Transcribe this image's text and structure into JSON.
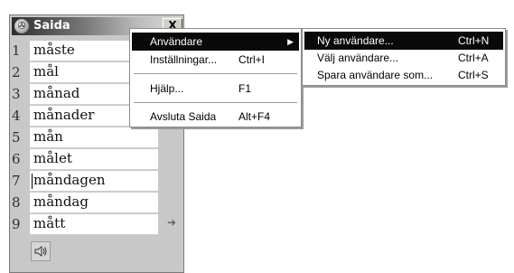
{
  "window": {
    "title": "Saida",
    "close_label": "X"
  },
  "word_list": [
    {
      "num": "1",
      "word": "måste"
    },
    {
      "num": "2",
      "word": "mål"
    },
    {
      "num": "3",
      "word": "månad"
    },
    {
      "num": "4",
      "word": "månader"
    },
    {
      "num": "5",
      "word": "mån"
    },
    {
      "num": "6",
      "word": "målet"
    },
    {
      "num": "7",
      "word": "måndagen"
    },
    {
      "num": "8",
      "word": "måndag"
    },
    {
      "num": "9",
      "word": "mått"
    }
  ],
  "icons": {
    "app": "saida-app-icon",
    "more": "arrow-right-icon",
    "speaker": "speaker-icon",
    "submenu": "submenu-arrow-icon"
  },
  "main_menu": {
    "items": [
      {
        "label": "Användare",
        "shortcut": ""
      },
      {
        "label": "Inställningar...",
        "shortcut": "Ctrl+I"
      },
      {
        "label": "Hjälp...",
        "shortcut": "F1"
      },
      {
        "label": "Avsluta Saida",
        "shortcut": "Alt+F4"
      }
    ]
  },
  "sub_menu": {
    "items": [
      {
        "label": "Ny användare...",
        "shortcut": "Ctrl+N"
      },
      {
        "label": "Välj användare...",
        "shortcut": "Ctrl+A"
      },
      {
        "label": "Spara användare som...",
        "shortcut": "Ctrl+S"
      }
    ]
  },
  "colors": {
    "highlight": "#0a0a0a",
    "window_bg": "#c8c8c8"
  }
}
